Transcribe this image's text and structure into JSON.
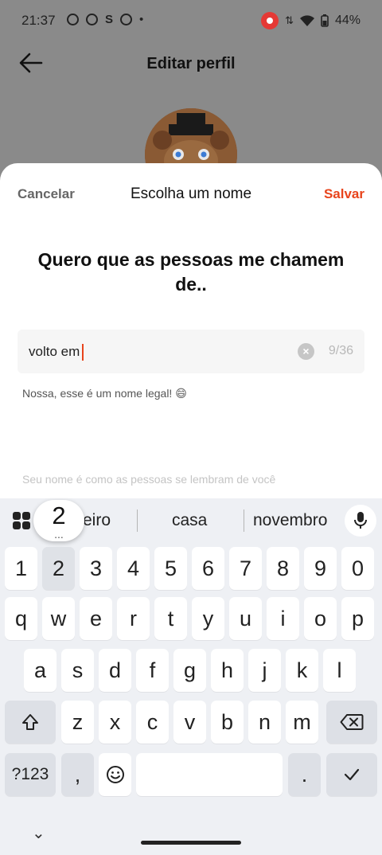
{
  "status_bar": {
    "time": "21:37",
    "battery": "44%"
  },
  "header": {
    "title": "Editar perfil"
  },
  "sheet": {
    "cancel_label": "Cancelar",
    "title": "Escolha um nome",
    "save_label": "Salvar",
    "heading": "Quero que as pessoas me chamem de..",
    "input_value": "volto em",
    "char_count": "9/36",
    "hint": "Nossa, esse é um nome legal! 😄",
    "subhint": "Seu nome é como as pessoas se lembram de você"
  },
  "keyboard": {
    "suggestions": [
      "eiro",
      "casa",
      "novembro"
    ],
    "popup_key": "2",
    "popup_more": "...",
    "row_numbers": [
      "1",
      "2",
      "3",
      "4",
      "5",
      "6",
      "7",
      "8",
      "9",
      "0"
    ],
    "row_q": [
      "q",
      "w",
      "e",
      "r",
      "t",
      "y",
      "u",
      "i",
      "o",
      "p"
    ],
    "row_a": [
      "a",
      "s",
      "d",
      "f",
      "g",
      "h",
      "j",
      "k",
      "l"
    ],
    "row_z": [
      "z",
      "x",
      "c",
      "v",
      "b",
      "n",
      "m"
    ],
    "symbols_label": "?123",
    "comma_label": ",",
    "period_label": "."
  },
  "colors": {
    "accent": "#e8441c",
    "dim_overlay": "#8a8a8a",
    "keyboard_bg": "#eef0f4"
  }
}
